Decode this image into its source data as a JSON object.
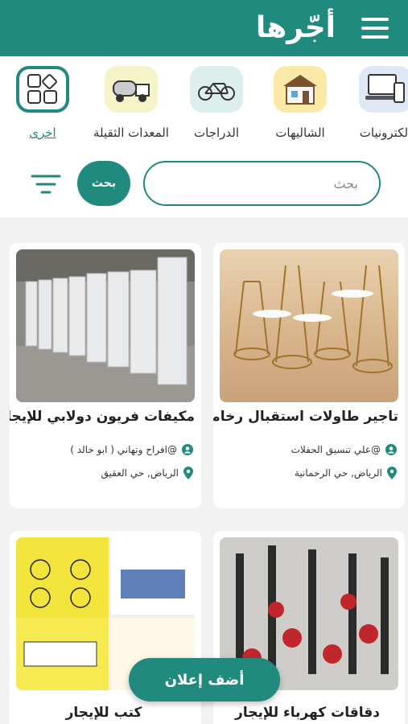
{
  "app": {
    "title": "أجّرها"
  },
  "categories": [
    {
      "label": "الكترونيات",
      "icon": "electronics-icon"
    },
    {
      "label": "الشاليهات",
      "icon": "chalet-icon"
    },
    {
      "label": "الدراجات",
      "icon": "bicycle-icon"
    },
    {
      "label": "المعدات الثقيلة",
      "icon": "truck-icon"
    },
    {
      "label": "اخرى",
      "icon": "grid-icon",
      "active": true
    }
  ],
  "search": {
    "placeholder": "بحث",
    "button": "بحث"
  },
  "listings": [
    {
      "title": "تاجير طاولات استقبال رخامية",
      "user": "@علي تنسيق الحفلات",
      "location": "الرياض, حي الرحمانية"
    },
    {
      "title": "مكيفات فريون دولابي للإيجار",
      "user": "@افراح وتهاني ( ابو خالد )",
      "location": "الرياض, حي العقيق"
    },
    {
      "title": "دقاقات كهرباء للإيجار",
      "user": "",
      "location": ""
    },
    {
      "title": "كتب للإيجار",
      "user": "",
      "location": ""
    }
  ],
  "fab": {
    "label": "أضف إعلان"
  },
  "colors": {
    "primary": "#1f8a7d",
    "background": "#f2f2f2"
  }
}
